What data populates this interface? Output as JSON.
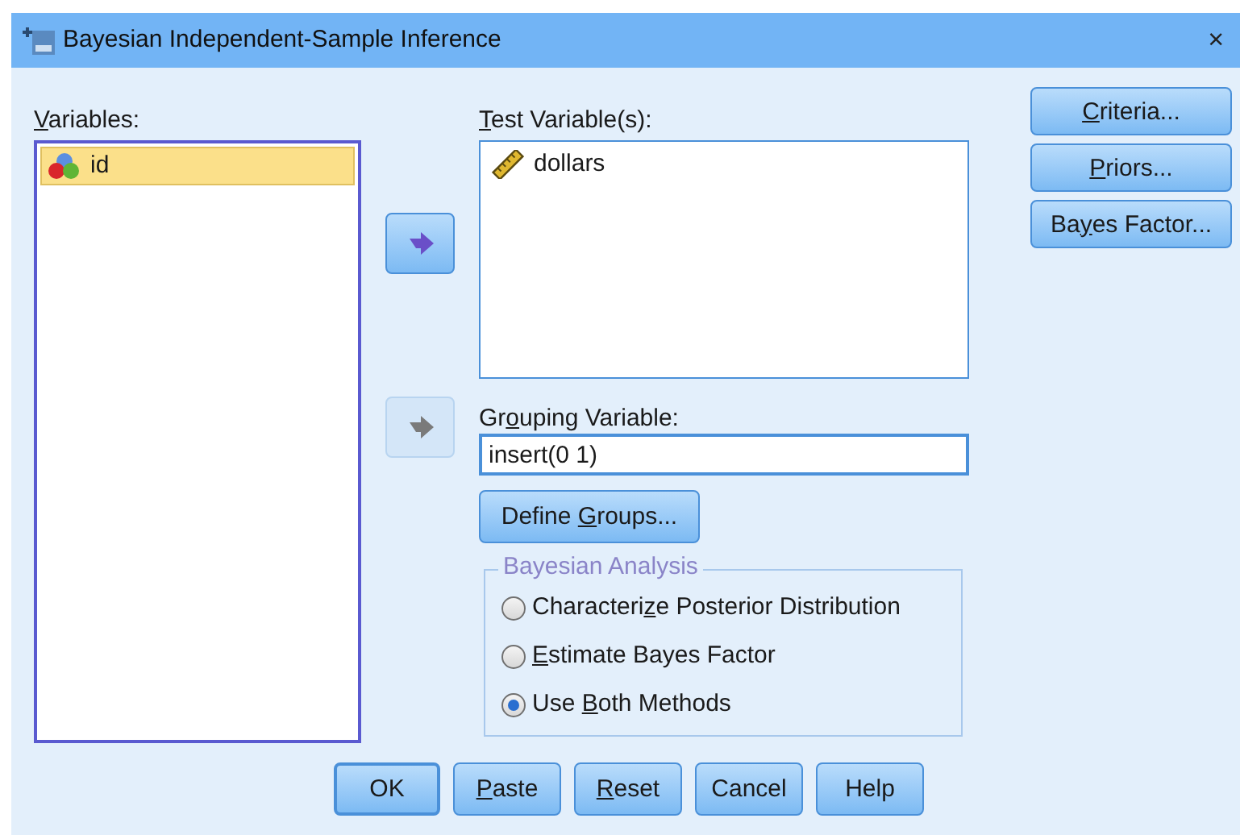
{
  "window": {
    "title": "Bayesian Independent-Sample Inference",
    "close": "×"
  },
  "variables": {
    "label": {
      "key": "V",
      "post": "ariables:"
    },
    "items": [
      {
        "name": "id",
        "kind": "nominal",
        "selected": true
      }
    ]
  },
  "move_buttons": [
    {
      "disabled": false
    },
    {
      "disabled": true
    }
  ],
  "test_variables": {
    "label": {
      "key": "T",
      "post": "est Variable(s):"
    },
    "items": [
      {
        "name": "dollars",
        "kind": "scale",
        "selected": false
      }
    ]
  },
  "side_buttons": [
    {
      "key": "C",
      "post": "riteria..."
    },
    {
      "key": "P",
      "post": "riors..."
    },
    {
      "pre": "Ba",
      "key": "y",
      "post": "es Factor..."
    }
  ],
  "grouping": {
    "label": {
      "pre": "Gr",
      "key": "o",
      "post": "uping Variable:"
    },
    "value": "insert(0 1)"
  },
  "define_groups": {
    "pre": "Define ",
    "key": "G",
    "post": "roups..."
  },
  "analysis": {
    "title": "Bayesian Analysis",
    "options": [
      {
        "pre": "Characteri",
        "key": "z",
        "post": "e Posterior Distribution",
        "selected": false
      },
      {
        "key": "E",
        "post": "stimate Bayes Factor",
        "selected": false
      },
      {
        "pre": "Use ",
        "key": "B",
        "post": "oth Methods",
        "selected": true
      }
    ]
  },
  "footer_buttons": [
    {
      "pre": "OK",
      "default": true
    },
    {
      "key": "P",
      "post": "aste",
      "default": false
    },
    {
      "key": "R",
      "post": "eset",
      "default": false
    },
    {
      "pre": "Cancel",
      "default": false
    },
    {
      "pre": "Help",
      "default": false
    }
  ]
}
